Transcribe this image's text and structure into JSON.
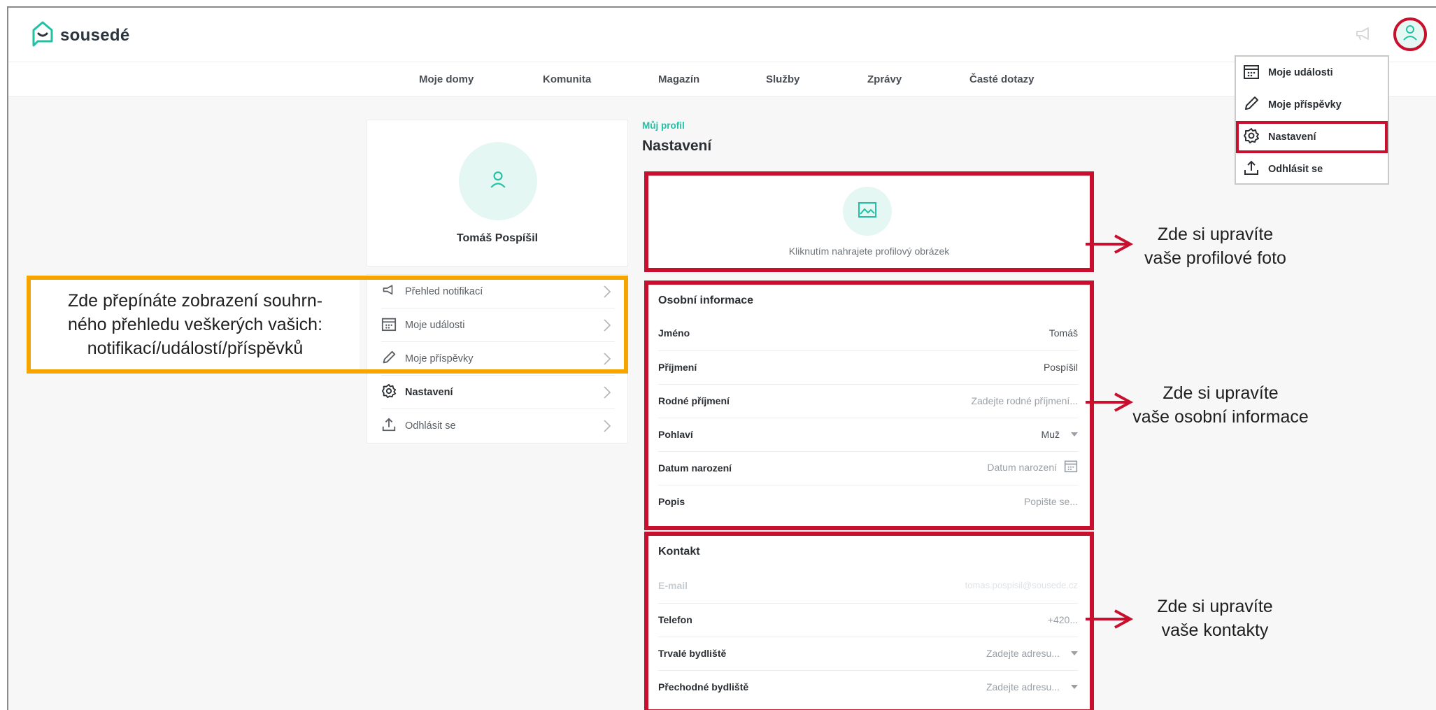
{
  "brand": {
    "name": "sousedé",
    "accent": "#21c1a6",
    "highlight_red": "#c8102e",
    "highlight_orange": "#f5a400"
  },
  "nav": {
    "items": [
      "Moje domy",
      "Komunita",
      "Magazín",
      "Služby",
      "Zprávy",
      "Časté dotazy"
    ]
  },
  "dropdown": {
    "items": [
      "Moje události",
      "Moje příspěvky",
      "Nastavení",
      "Odhlásit se"
    ]
  },
  "profile": {
    "name": "Tomáš Pospíšil"
  },
  "side_menu": {
    "items": [
      "Přehled notifikací",
      "Moje události",
      "Moje příspěvky",
      "Nastavení",
      "Odhlásit se"
    ]
  },
  "main": {
    "breadcrumb": "Můj profil",
    "title": "Nastavení",
    "upload_text": "Kliknutím nahrajete profilový obrázek",
    "personal": {
      "title": "Osobní informace",
      "fields": [
        {
          "label": "Jméno",
          "value": "Tomáš"
        },
        {
          "label": "Příjmení",
          "value": "Pospíšil"
        },
        {
          "label": "Rodné příjmení",
          "value": "Zadejte rodné příjmení..."
        },
        {
          "label": "Pohlaví",
          "value": "Muž"
        },
        {
          "label": "Datum narození",
          "value": "Datum narození"
        },
        {
          "label": "Popis",
          "value": "Popište se..."
        }
      ]
    },
    "contact": {
      "title": "Kontakt",
      "fields": [
        {
          "label": "E-mail",
          "value": "tomas.pospisil@sousede.cz"
        },
        {
          "label": "Telefon",
          "value": "+420..."
        },
        {
          "label": "Trvalé bydliště",
          "value": "Zadejte adresu..."
        },
        {
          "label": "Přechodné bydliště",
          "value": "Zadejte adresu..."
        }
      ]
    }
  },
  "annotations": {
    "orange": [
      "Zde přepínáte zobrazení souhrn-",
      "ného přehledu veškerých vašich:",
      "notifikací/událostí/příspěvků"
    ],
    "photo": [
      "Zde si upravíte",
      "vaše profilové foto"
    ],
    "personal": [
      "Zde si upravíte",
      "vaše osobní informace"
    ],
    "contact": [
      "Zde si upravíte",
      "vaše kontakty"
    ]
  }
}
